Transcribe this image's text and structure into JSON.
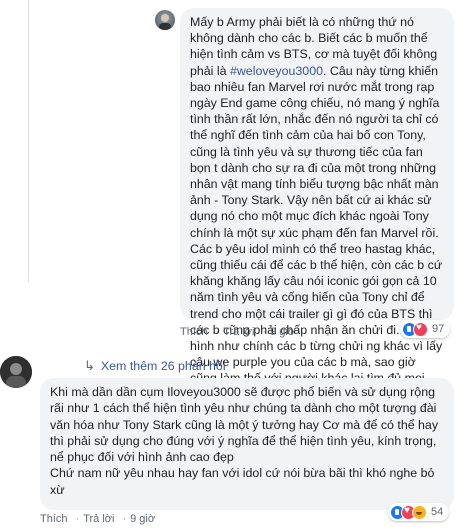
{
  "reply": {
    "text_1": "Mấy b Army phải biết là có những thứ nó không dành cho các b. Biết các b muốn thể hiện tình cảm vs BTS, cơ mà tuyệt đối không phải là ",
    "hashtag": "#weloveyou3000",
    "text_2": ". Câu này từng khiến bao nhiêu fan Marvel rơi nước mắt trong rạp ngày End game công chiếu, nó mang ý nghĩa tình thần rất lớn, nhắc đến nó người ta chỉ có thể nghĩ đến tình cảm của hai bố con Tony, cũng là tình yêu và sự thương tiếc của fan bọn t dành cho sự ra đi của một trong những nhân vật mang tính biểu tượng bậc nhất màn ảnh - Tony Stark. Vậy nên bất cứ ai khác sử dụng nó cho một mục đích khác ngoài Tony chính là một sự xúc phạm đến fan Marvel rồi. Các b yêu idol mình có thể treo hastag khác, cũng thiếu cái để các b thể hiện, còn các b cứ khăng khăng lấy câu nói iconic gói gọn cả 10 năm tình yêu và cống hiến của Tony chỉ để trend cho một cái trailer gì gì đó của BTS thì các b cũng phải chấp nhận ăn chửi đi. Mà hình như chính các b từng chửi ng khác vì lấy câu we purple you của các b mà, sao giờ cũng làm thế với người khác lại tìm đủ mọi cách để biện minh v\nTrích comment của bạn khác",
    "like": "Thích",
    "reply": "Trả lời",
    "time": "9 giờ",
    "reaction_count": "97"
  },
  "more_replies": {
    "label": "Xem thêm 26 phản hồi"
  },
  "comment": {
    "text": "Khi mà dần dần cụm Iloveyou3000 sẽ được phổ biến và sử dụng rộng rãi như 1 cách thể hiện tình yêu như chúng ta dành cho một tượng đài văn hóa như Tony Stark cũng là một ý tưởng hay Cơ mà để có thể hay thì phải sử dụng cho đúng với ý nghĩa để thể hiện tình yêu, kính trọng, nể phục đối với hình ảnh cao đẹp\nChứ nam nữ yêu nhau hay fan với idol cứ nói bừa bãi thì khó nghe bỏ xừ",
    "like": "Thích",
    "reply": "Trả lời",
    "time": "9 giờ",
    "reaction_count": "54"
  }
}
